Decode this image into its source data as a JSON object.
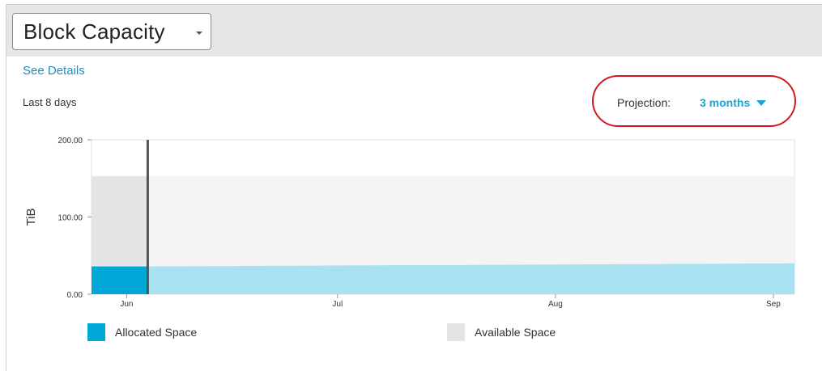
{
  "header": {
    "title": "Block Capacity"
  },
  "links": {
    "see_details": "See Details"
  },
  "range_label": "Last 8 days",
  "projection": {
    "label": "Projection:",
    "value": "3 months"
  },
  "colors": {
    "allocated": "#00a8d8",
    "allocated_projected": "#a9e1f0",
    "available": "#e3e4e6",
    "available_projected": "#f4f4f4",
    "today_line": "#555555",
    "highlight_ring": "#d0191f",
    "link": "#1a8fc4",
    "accent": "#1aa3dc"
  },
  "chart_data": {
    "type": "area",
    "ylabel": "TiB",
    "ylim": [
      0,
      200
    ],
    "yticks": [
      "200.00",
      "100.00",
      "0.00"
    ],
    "ytick_values": [
      200,
      100,
      0
    ],
    "x_tick_labels": [
      "Jun",
      "Jul",
      "Aug",
      "Sep"
    ],
    "x_domain": [
      "2016-05-27",
      "2016-09-04"
    ],
    "x_tick_dates": [
      "2016-06-01",
      "2016-07-01",
      "2016-08-01",
      "2016-09-01"
    ],
    "today": "2016-06-04",
    "series": [
      {
        "name": "Allocated Space",
        "points": [
          [
            "2016-05-27",
            36
          ],
          [
            "2016-06-04",
            36
          ],
          [
            "2016-09-04",
            40
          ]
        ]
      },
      {
        "name": "Available Space",
        "points": [
          [
            "2016-05-27",
            153
          ],
          [
            "2016-06-04",
            153
          ],
          [
            "2016-09-04",
            153
          ]
        ]
      }
    ],
    "legend": [
      "Allocated Space",
      "Available Space"
    ]
  }
}
